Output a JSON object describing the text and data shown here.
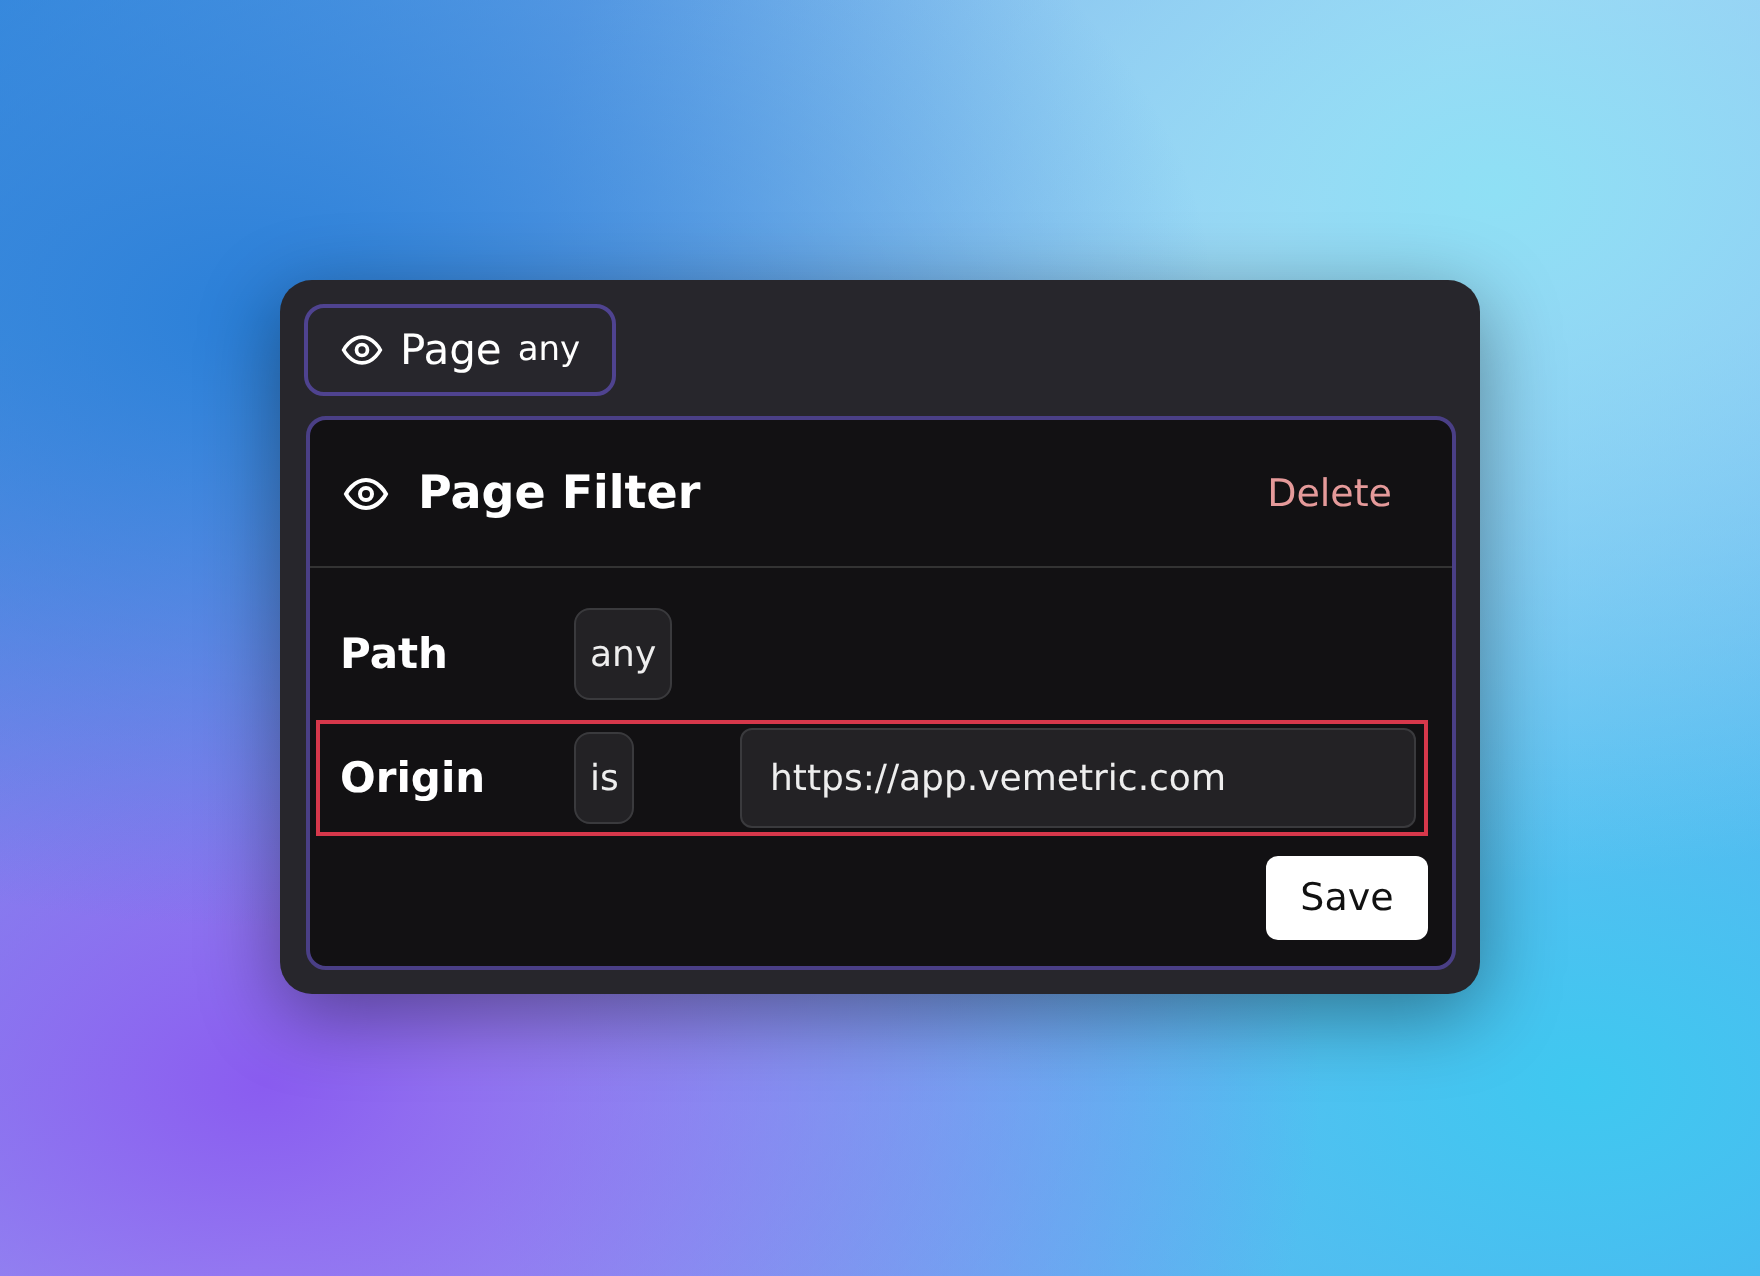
{
  "chip": {
    "label": "Page",
    "value": "any"
  },
  "filter": {
    "title": "Page Filter",
    "delete": "Delete",
    "rows": [
      {
        "label": "Path",
        "operator": "any",
        "highlighted": false
      },
      {
        "label": "Origin",
        "operator": "is",
        "value": "https://app.vemetric.com",
        "highlighted": true
      }
    ],
    "save": "Save"
  }
}
